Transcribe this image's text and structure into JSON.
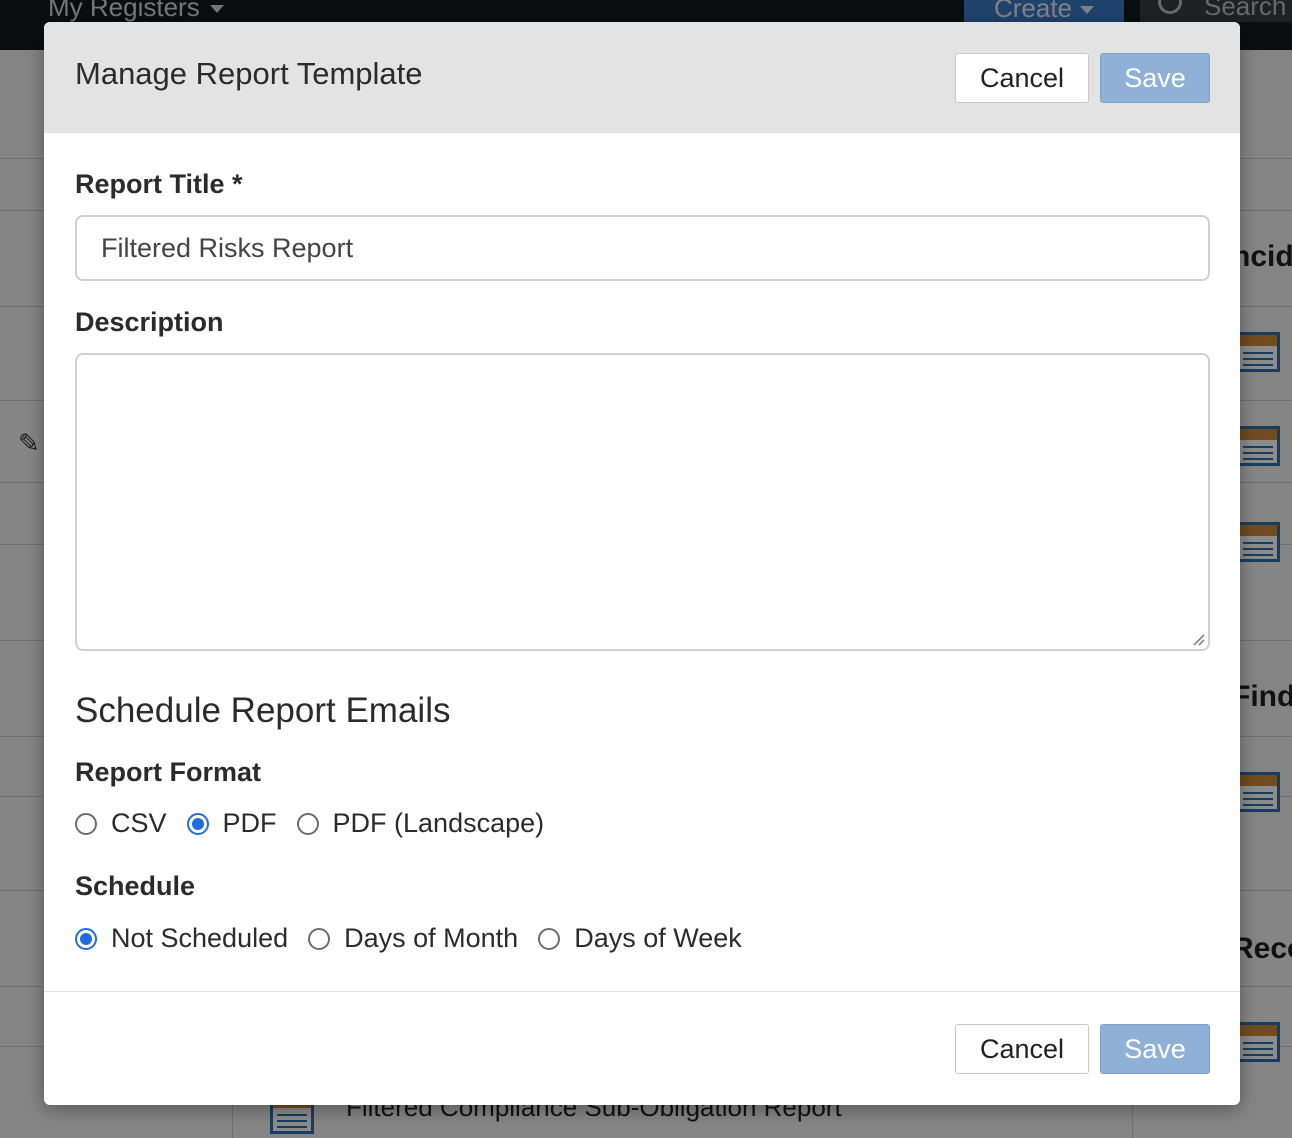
{
  "background": {
    "menu_registers": "My Registers",
    "create_label": "Create",
    "search_label": "Search",
    "partial_texts": [
      "ncid",
      "Findi",
      "Reco"
    ],
    "footer_row_text": "Filtered Compliance Sub-Obligation Report"
  },
  "modal": {
    "title": "Manage Report Template",
    "cancel_label": "Cancel",
    "save_label": "Save",
    "report_title_label": "Report Title *",
    "report_title_value": "Filtered Risks Report",
    "description_label": "Description",
    "description_value": "",
    "schedule_section_title": "Schedule Report Emails",
    "format_label": "Report Format",
    "format_options": [
      {
        "label": "CSV",
        "selected": false
      },
      {
        "label": "PDF",
        "selected": true
      },
      {
        "label": "PDF (Landscape)",
        "selected": false
      }
    ],
    "schedule_label": "Schedule",
    "schedule_options": [
      {
        "label": "Not Scheduled",
        "selected": true
      },
      {
        "label": "Days of Month",
        "selected": false
      },
      {
        "label": "Days of Week",
        "selected": false
      }
    ]
  },
  "colors": {
    "save_button": "#8fb0d7",
    "radio_selected": "#1f6ddb",
    "header_bg": "#e3e3e3"
  }
}
